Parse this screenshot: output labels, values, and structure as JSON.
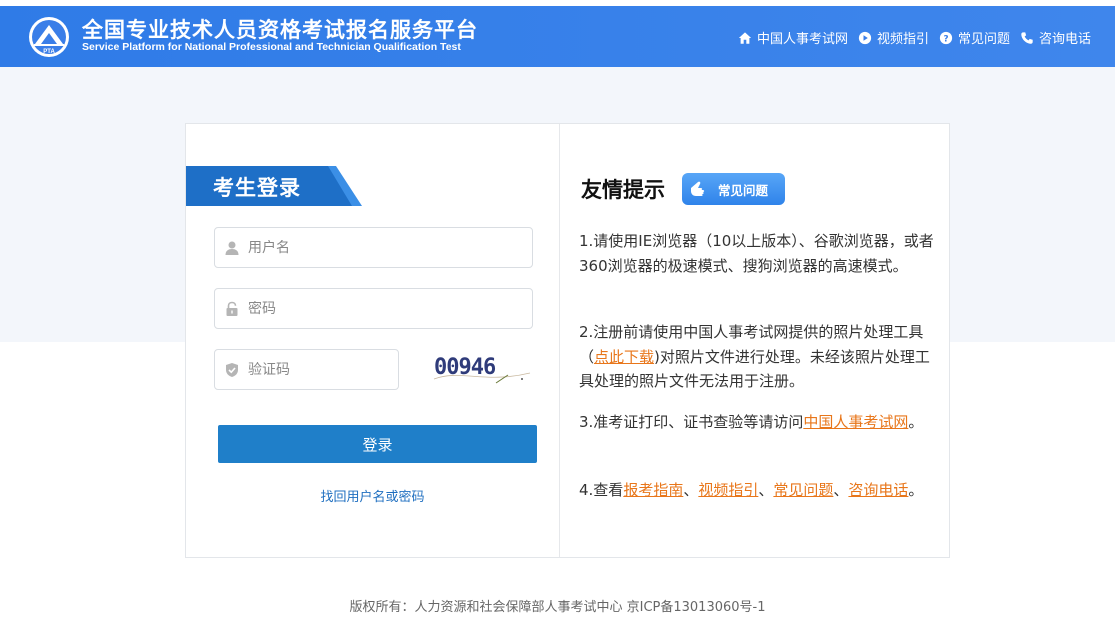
{
  "header": {
    "title_cn": "全国专业技术人员资格考试报名服务平台",
    "title_en": "Service Platform for National Professional and Technician Qualification Test",
    "logo_text": "PTA",
    "nav": [
      {
        "label": "中国人事考试网",
        "icon": "home-icon"
      },
      {
        "label": "视频指引",
        "icon": "play-icon"
      },
      {
        "label": "常见问题",
        "icon": "question-icon"
      },
      {
        "label": "咨询电话",
        "icon": "phone-icon"
      }
    ]
  },
  "login": {
    "tab_label": "考生登录",
    "username_placeholder": "用户名",
    "password_placeholder": "密码",
    "captcha_placeholder": "验证码",
    "captcha_text": "00946",
    "submit_label": "登录",
    "recover_label": "找回用户名或密码"
  },
  "tips": {
    "title": "友情提示",
    "faq_badge": "常见问题",
    "tip1": "1.请使用IE浏览器（10以上版本）、谷歌浏览器，或者360浏览器的极速模式、搜狗浏览器的高速模式。",
    "tip2_a": "2.注册前请使用中国人事考试网提供的照片处理工具（",
    "tip2_link": "点此下载",
    "tip2_b": ")对照片文件进行处理。未经该照片处理工具处理的照片文件无法用于注册。",
    "tip3_a": "3.准考证打印、证书查验等请访问",
    "tip3_link": "中国人事考试网",
    "tip3_b": "。",
    "tip4_a": "4.查看",
    "tip4_link1": "报考指南",
    "sep1": "、",
    "tip4_link2": "视频指引",
    "sep2": "、",
    "tip4_link3": "常见问题",
    "sep3": "、",
    "tip4_link4": "咨询电话",
    "tip4_b": "。"
  },
  "footer": {
    "copyright": "版权所有：人力资源和社会保障部人事考试中心 京ICP备13013060号-1"
  },
  "colors": {
    "header_bg": "#3a7ee8",
    "primary_button": "#1f7fc9",
    "link_orange": "#e8761a"
  }
}
